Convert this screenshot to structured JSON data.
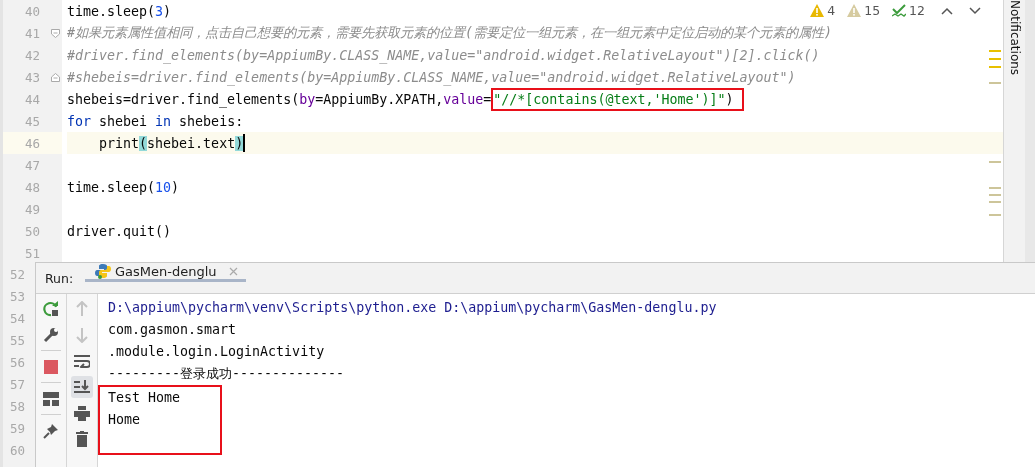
{
  "inspections": [
    {
      "kind": "warning",
      "count": "4"
    },
    {
      "kind": "weak",
      "count": "15"
    },
    {
      "kind": "typo",
      "count": "12"
    }
  ],
  "code": {
    "lines": [
      {
        "number": "40",
        "tokens": [
          {
            "kind": "plain",
            "text": "time.sleep("
          },
          {
            "kind": "number",
            "text": "3"
          },
          {
            "kind": "plain",
            "text": ")"
          }
        ]
      },
      {
        "number": "41",
        "fold_start": true,
        "tokens": [
          {
            "kind": "comment",
            "text": "#如果元素属性值相同，点击自己想要的元素，需要先获取元素的位置(需要定位一组元素，在一组元素中定位启动的某个元素的属性)"
          }
        ]
      },
      {
        "number": "42",
        "tokens": [
          {
            "kind": "comment",
            "text": "#driver.find_elements(by=AppiumBy.CLASS_NAME,value=\"android.widget.RelativeLayout\")[2].click()"
          }
        ]
      },
      {
        "number": "43",
        "fold_end": true,
        "tokens": [
          {
            "kind": "comment",
            "text": "#shebeis=driver.find_elements(by=AppiumBy.CLASS_NAME,value=\"android.widget.RelativeLayout\")"
          }
        ]
      },
      {
        "number": "44",
        "tokens": [
          {
            "kind": "plain",
            "text": "shebeis=driver.find_elements("
          },
          {
            "kind": "param",
            "text": "by"
          },
          {
            "kind": "plain",
            "text": "=AppiumBy.XPATH,"
          },
          {
            "kind": "param",
            "text": "value"
          },
          {
            "kind": "plain",
            "text": "="
          },
          {
            "kind": "string",
            "text": "\"//*[contains(@text,'Home')]\"",
            "highlighted": true
          },
          {
            "kind": "plain",
            "text": ")",
            "highlighted": true
          }
        ]
      },
      {
        "number": "45",
        "tokens": [
          {
            "kind": "keyword",
            "text": "for"
          },
          {
            "kind": "plain",
            "text": " shebei "
          },
          {
            "kind": "keyword",
            "text": "in"
          },
          {
            "kind": "plain",
            "text": " shebeis:"
          }
        ]
      },
      {
        "number": "46",
        "current": true,
        "caret": true,
        "tokens": [
          {
            "kind": "plain",
            "text": "    print"
          },
          {
            "kind": "match",
            "text": "("
          },
          {
            "kind": "plain",
            "text": "shebei.text"
          },
          {
            "kind": "match",
            "text": ")"
          }
        ]
      },
      {
        "number": "47"
      },
      {
        "number": "48",
        "tokens": [
          {
            "kind": "plain",
            "text": "time.sleep("
          },
          {
            "kind": "number",
            "text": "10"
          },
          {
            "kind": "plain",
            "text": ")"
          }
        ]
      },
      {
        "number": "49"
      },
      {
        "number": "50",
        "tokens": [
          {
            "kind": "plain",
            "text": "driver.quit()"
          }
        ]
      },
      {
        "number": "51"
      }
    ]
  },
  "notifications": {
    "label": "Notifications"
  },
  "gutter_numbers": [
    "52",
    "53",
    "54",
    "55",
    "56",
    "57",
    "58",
    "59",
    "60"
  ],
  "run": {
    "label": "Run:",
    "tab": {
      "title": "GasMen-denglu",
      "selected": true
    },
    "toolbar_left": [
      {
        "kind": "rerun"
      },
      {
        "kind": "wrench"
      },
      {
        "kind": "stop"
      },
      {
        "kind": "layout"
      },
      {
        "kind": "pin"
      }
    ],
    "toolbar_right": [
      {
        "kind": "up",
        "disabled": true,
        "selected": false
      },
      {
        "kind": "down",
        "disabled": true,
        "selected": false
      },
      {
        "kind": "wrap",
        "disabled": false,
        "selected": false
      },
      {
        "kind": "scroll-end",
        "disabled": false,
        "selected": true
      },
      {
        "kind": "print",
        "disabled": false,
        "selected": false
      },
      {
        "kind": "trash",
        "disabled": false,
        "selected": false
      }
    ],
    "console": [
      {
        "kind": "system",
        "text": "D:\\appium\\pycharm\\venv\\Scripts\\python.exe D:\\appium\\pycharm\\GasMen-denglu.py",
        "highlighted": false
      },
      {
        "kind": "output",
        "text": "com.gasmon.smart",
        "highlighted": false
      },
      {
        "kind": "output",
        "text": ".module.login.LoginActivity",
        "highlighted": false
      },
      {
        "kind": "output",
        "text": "---------登录成功--------------",
        "highlighted": false
      },
      {
        "kind": "output",
        "text": "Test Home",
        "highlighted": true
      },
      {
        "kind": "output",
        "text": "Home",
        "highlighted": true
      }
    ]
  }
}
